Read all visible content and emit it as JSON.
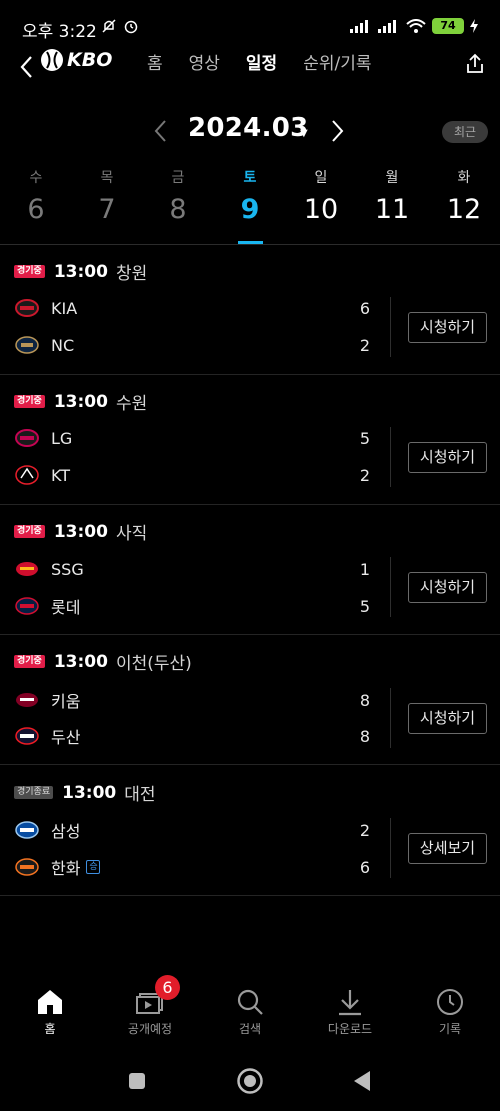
{
  "status": {
    "time": "오후 3:22",
    "battery": "74"
  },
  "nav": {
    "logo": "KBO",
    "tabs": [
      {
        "label": "홈",
        "active": false
      },
      {
        "label": "영상",
        "active": false
      },
      {
        "label": "일정",
        "active": true
      },
      {
        "label": "순위/기록",
        "active": false
      }
    ]
  },
  "month": {
    "label": "2024.03",
    "recent_label": "최근"
  },
  "week": [
    {
      "dow": "수",
      "num": "6"
    },
    {
      "dow": "목",
      "num": "7"
    },
    {
      "dow": "금",
      "num": "8"
    },
    {
      "dow": "토",
      "num": "9"
    },
    {
      "dow": "일",
      "num": "10"
    },
    {
      "dow": "월",
      "num": "11"
    },
    {
      "dow": "화",
      "num": "12"
    }
  ],
  "games": [
    {
      "status": "경기중",
      "time": "13:00",
      "place": "창원",
      "home": {
        "name": "KIA",
        "score": "6"
      },
      "away": {
        "name": "NC",
        "score": "2"
      },
      "action": "시청하기"
    },
    {
      "status": "경기중",
      "time": "13:00",
      "place": "수원",
      "home": {
        "name": "LG",
        "score": "5"
      },
      "away": {
        "name": "KT",
        "score": "2"
      },
      "action": "시청하기"
    },
    {
      "status": "경기중",
      "time": "13:00",
      "place": "사직",
      "home": {
        "name": "SSG",
        "score": "1"
      },
      "away": {
        "name": "롯데",
        "score": "5"
      },
      "action": "시청하기"
    },
    {
      "status": "경기중",
      "time": "13:00",
      "place": "이천(두산)",
      "home": {
        "name": "키움",
        "score": "8"
      },
      "away": {
        "name": "두산",
        "score": "8"
      },
      "action": "시청하기"
    },
    {
      "status": "경기종료",
      "time": "13:00",
      "place": "대전",
      "home": {
        "name": "삼성",
        "score": "2"
      },
      "away": {
        "name": "한화",
        "score": "6",
        "win_badge": "승"
      },
      "action": "상세보기"
    }
  ],
  "bottom_nav": [
    {
      "label": "홈",
      "icon": "home-icon"
    },
    {
      "label": "공개예정",
      "icon": "upcoming-icon",
      "badge": "6"
    },
    {
      "label": "검색",
      "icon": "search-icon"
    },
    {
      "label": "다운로드",
      "icon": "download-icon"
    },
    {
      "label": "기록",
      "icon": "history-icon"
    }
  ],
  "colors": {
    "accent": "#19b6f0",
    "live": "#e11d48",
    "background": "#000000"
  }
}
